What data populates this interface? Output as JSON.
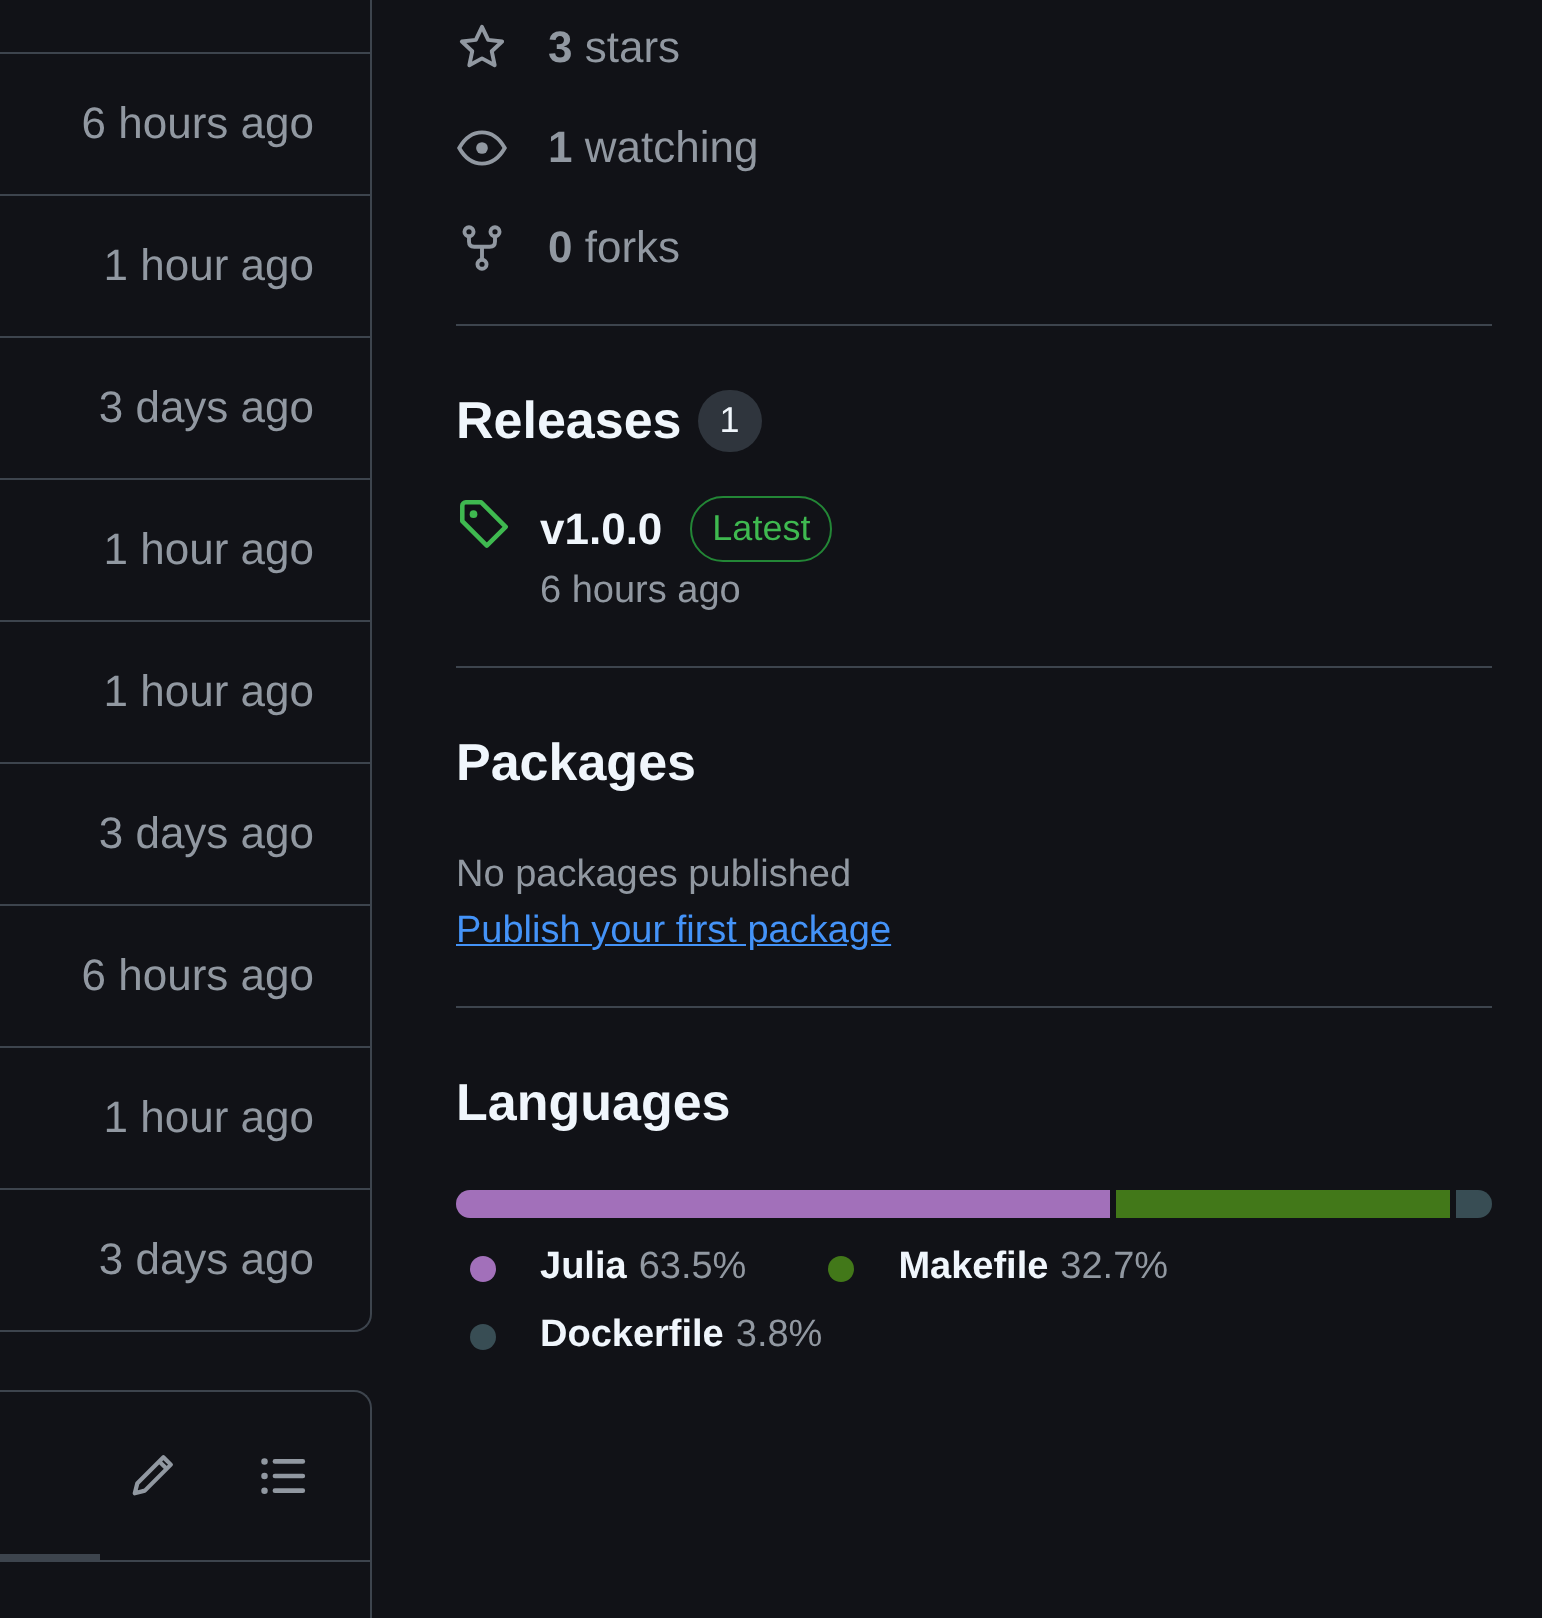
{
  "commits": [
    {
      "time": "6 hours ago"
    },
    {
      "time": "1 hour ago"
    },
    {
      "time": "3 days ago"
    },
    {
      "time": "1 hour ago"
    },
    {
      "time": "1 hour ago"
    },
    {
      "time": "3 days ago"
    },
    {
      "time": "6 hours ago"
    },
    {
      "time": "1 hour ago"
    },
    {
      "time": "3 days ago"
    }
  ],
  "stats": [
    {
      "kind": "stars",
      "count": "3",
      "label": "stars"
    },
    {
      "kind": "watching",
      "count": "1",
      "label": "watching"
    },
    {
      "kind": "forks",
      "count": "0",
      "label": "forks"
    }
  ],
  "releases": {
    "title": "Releases",
    "count": "1",
    "items": [
      {
        "name": "v1.0.0",
        "badge": "Latest",
        "time": "6 hours ago"
      }
    ]
  },
  "packages": {
    "title": "Packages",
    "text": "No packages published",
    "link": "Publish your first package"
  },
  "languages": {
    "title": "Languages",
    "items": [
      {
        "name": "Julia",
        "percent": "63.5%",
        "color": "#a270ba"
      },
      {
        "name": "Makefile",
        "percent": "32.7%",
        "color": "#427819"
      },
      {
        "name": "Dockerfile",
        "percent": "3.8%",
        "color": "#384d54"
      }
    ]
  }
}
